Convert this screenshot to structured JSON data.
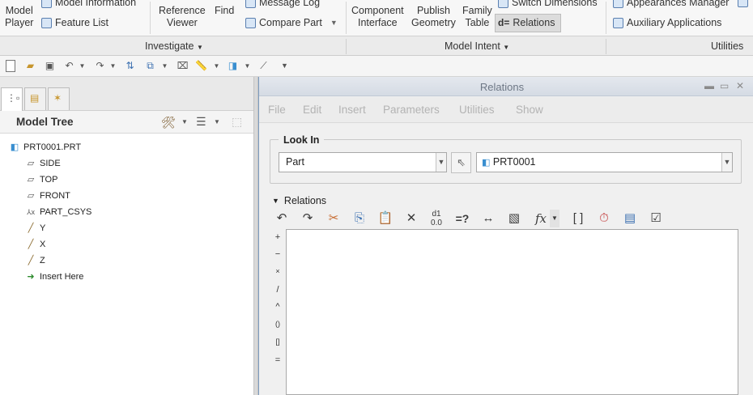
{
  "ribbon": {
    "model_player": "Model\nPlayer",
    "model_information": "Model Information",
    "feature_list": "Feature List",
    "reference_viewer": "Reference\nViewer",
    "find": "Find",
    "message_log": "Message Log",
    "compare_part": "Compare Part",
    "component_interface": "Component\nInterface",
    "publish_geometry": "Publish\nGeometry",
    "family_table": "Family\nTable",
    "switch_dimensions": "Switch Dimensions",
    "relations": "Relations",
    "appearances_manager": "Appearances Manager",
    "auxiliary_applications": "Auxiliary Applications"
  },
  "groups": {
    "investigate": "Investigate",
    "model_intent": "Model Intent",
    "utilities": "Utilities"
  },
  "model_tree": {
    "title": "Model Tree",
    "items": [
      {
        "label": "PRT0001.PRT",
        "icon": "part-icon"
      },
      {
        "label": "SIDE",
        "icon": "datum-plane-icon"
      },
      {
        "label": "TOP",
        "icon": "datum-plane-icon"
      },
      {
        "label": "FRONT",
        "icon": "datum-plane-icon"
      },
      {
        "label": "PART_CSYS",
        "icon": "csys-icon"
      },
      {
        "label": "Y",
        "icon": "datum-axis-icon"
      },
      {
        "label": "X",
        "icon": "datum-axis-icon"
      },
      {
        "label": "Z",
        "icon": "datum-axis-icon"
      },
      {
        "label": "Insert Here",
        "icon": "insert-arrow-icon"
      }
    ]
  },
  "dialog": {
    "title": "Relations",
    "menu": [
      "File",
      "Edit",
      "Insert",
      "Parameters",
      "Utilities",
      "Show"
    ],
    "look_in": {
      "label": "Look In",
      "type_value": "Part",
      "target_value": "PRT0001"
    },
    "relations_section": "Relations",
    "operators": [
      "+",
      "−",
      "×",
      "/",
      "^",
      "()",
      "[]",
      "="
    ],
    "editor_value": ""
  },
  "colors": {
    "ribbon_bg": "#f7f7f7",
    "dialog_border": "#7d9cc0",
    "menu_disabled": "#b3b3b3"
  }
}
